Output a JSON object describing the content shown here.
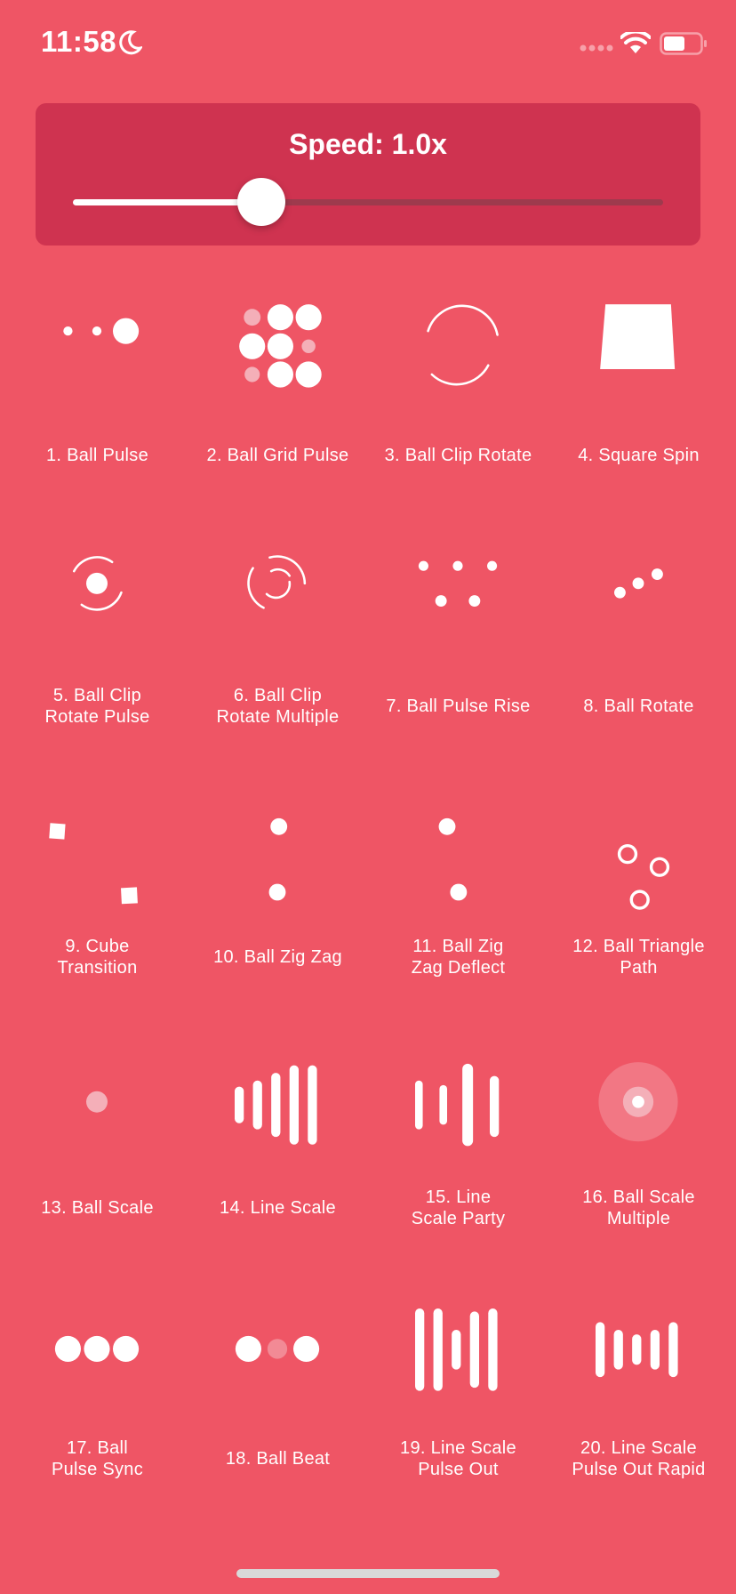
{
  "status_bar": {
    "time": "11:58"
  },
  "speed": {
    "label": "Speed: 1.0x",
    "value": 1.0,
    "fraction": 0.32
  },
  "colors": {
    "background": "#EF5565",
    "panel": "#CF3350",
    "foreground": "#FFFFFF"
  },
  "indicators": [
    {
      "label": "1. Ball Pulse",
      "icon": "ball-pulse"
    },
    {
      "label": "2. Ball Grid Pulse",
      "icon": "ball-grid-pulse"
    },
    {
      "label": "3. Ball Clip Rotate",
      "icon": "ball-clip-rotate"
    },
    {
      "label": "4. Square Spin",
      "icon": "square-spin"
    },
    {
      "label": "5. Ball Clip\nRotate Pulse",
      "icon": "ball-clip-rotate-pulse"
    },
    {
      "label": "6. Ball Clip\nRotate Multiple",
      "icon": "ball-clip-rotate-multiple"
    },
    {
      "label": "7. Ball Pulse Rise",
      "icon": "ball-pulse-rise"
    },
    {
      "label": "8. Ball Rotate",
      "icon": "ball-rotate"
    },
    {
      "label": "9. Cube\nTransition",
      "icon": "cube-transition"
    },
    {
      "label": "10. Ball Zig Zag",
      "icon": "ball-zig-zag"
    },
    {
      "label": "11. Ball Zig\nZag Deflect",
      "icon": "ball-zig-zag-deflect"
    },
    {
      "label": "12. Ball Triangle\nPath",
      "icon": "ball-triangle-path"
    },
    {
      "label": "13. Ball Scale",
      "icon": "ball-scale"
    },
    {
      "label": "14. Line Scale",
      "icon": "line-scale"
    },
    {
      "label": "15. Line\nScale Party",
      "icon": "line-scale-party"
    },
    {
      "label": "16. Ball Scale\nMultiple",
      "icon": "ball-scale-multiple"
    },
    {
      "label": "17. Ball\nPulse Sync",
      "icon": "ball-pulse-sync"
    },
    {
      "label": "18. Ball Beat",
      "icon": "ball-beat"
    },
    {
      "label": "19. Line Scale\nPulse Out",
      "icon": "line-scale-pulse-out"
    },
    {
      "label": "20. Line Scale\nPulse Out Rapid",
      "icon": "line-scale-pulse-out-rapid"
    }
  ]
}
